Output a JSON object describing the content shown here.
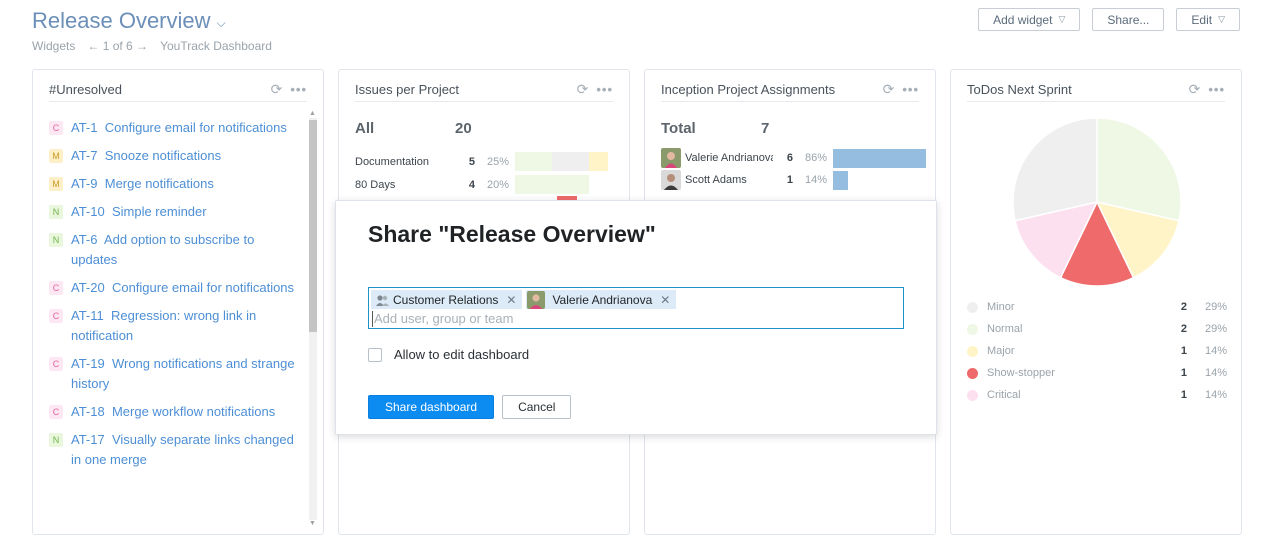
{
  "header": {
    "title": "Release Overview",
    "breadcrumbs": [
      "Widgets",
      "← 1 of 6 →",
      "YouTrack Dashboard"
    ],
    "toolbar": {
      "add_widget": "Add widget",
      "share": "Share...",
      "edit": "Edit"
    }
  },
  "widgets": {
    "unresolved": {
      "title": "#Unresolved",
      "issues": [
        {
          "badge": "C",
          "id": "AT-1",
          "summary": "Configure email for notifications"
        },
        {
          "badge": "M",
          "id": "AT-7",
          "summary": "Snooze notifications"
        },
        {
          "badge": "M",
          "id": "AT-9",
          "summary": "Merge notifications"
        },
        {
          "badge": "N",
          "id": "AT-10",
          "summary": "Simple reminder"
        },
        {
          "badge": "N",
          "id": "AT-6",
          "summary": "Add option to subscribe to updates"
        },
        {
          "badge": "C",
          "id": "AT-20",
          "summary": "Configure email for notifications"
        },
        {
          "badge": "C",
          "id": "AT-11",
          "summary": "Regression: wrong link in notification"
        },
        {
          "badge": "C",
          "id": "AT-19",
          "summary": "Wrong notifications and strange history"
        },
        {
          "badge": "C",
          "id": "AT-18",
          "summary": "Merge workflow notifications"
        },
        {
          "badge": "N",
          "id": "AT-17",
          "summary": "Visually separate links changed in one merge"
        }
      ]
    },
    "issues_per_project": {
      "title": "Issues per Project",
      "total_label": "All",
      "total": "20",
      "rows": [
        {
          "name": "Documentation",
          "count": "5",
          "pct": "25%",
          "fraction": 0.25
        },
        {
          "name": "80 Days",
          "count": "4",
          "pct": "20%",
          "fraction": 0.2
        }
      ],
      "colors": [
        "#eef8e4",
        "#efefef",
        "#fff4c7",
        "#ef6a6a"
      ]
    },
    "assignments": {
      "title": "Inception Project Assignments",
      "total_label": "Total",
      "total": "7",
      "rows": [
        {
          "name": "Valerie Andrianova",
          "count": "6",
          "pct": "86%",
          "fraction": 0.86,
          "avatar": "woman-avatar"
        },
        {
          "name": "Scott Adams",
          "count": "1",
          "pct": "14%",
          "fraction": 0.14,
          "avatar": "man-avatar"
        }
      ],
      "bar_color": "#94bde0"
    },
    "todos": {
      "title": "ToDos Next Sprint",
      "chart_data": {
        "type": "pie",
        "categories": [
          "Minor",
          "Normal",
          "Major",
          "Show-stopper",
          "Critical"
        ],
        "values": [
          2,
          2,
          1,
          1,
          1
        ],
        "labels_pct": [
          "29%",
          "29%",
          "14%",
          "14%",
          "14%"
        ],
        "colors": [
          "#efefef",
          "#eef8e4",
          "#fff4c7",
          "#ef6a6a",
          "#fde0ef"
        ]
      }
    }
  },
  "dialog": {
    "title": "Share \"Release Overview\"",
    "chips": [
      {
        "label": "Customer Relations",
        "icon": "group-icon"
      },
      {
        "label": "Valerie Andrianova",
        "icon": "woman-avatar"
      }
    ],
    "input_placeholder": "Add user, group or team",
    "checkbox_label": "Allow to edit dashboard",
    "primary_button": "Share dashboard",
    "cancel_button": "Cancel",
    "accent": "#0c8bf1"
  }
}
